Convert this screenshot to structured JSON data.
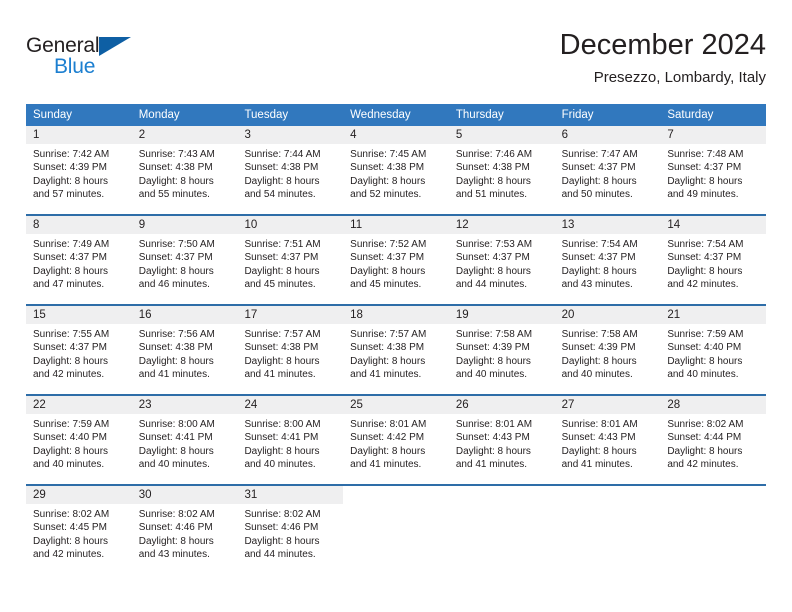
{
  "brand": {
    "name_part1": "General",
    "name_part2": "Blue",
    "flag_icon": "triangle-flag-icon"
  },
  "header": {
    "title": "December 2024",
    "subtitle": "Presezzo, Lombardy, Italy"
  },
  "colors": {
    "header_blue": "#3178be",
    "week_border_blue": "#2e6da8",
    "daynum_background": "#efeff0",
    "brand_blue": "#1c7fd0",
    "brand_flag": "#0e5fa4",
    "text": "#231f20"
  },
  "calendar": {
    "weekday_headers": [
      "Sunday",
      "Monday",
      "Tuesday",
      "Wednesday",
      "Thursday",
      "Friday",
      "Saturday"
    ],
    "weeks": [
      [
        {
          "day": "1",
          "sunrise": "Sunrise: 7:42 AM",
          "sunset": "Sunset: 4:39 PM",
          "daylight1": "Daylight: 8 hours",
          "daylight2": "and 57 minutes."
        },
        {
          "day": "2",
          "sunrise": "Sunrise: 7:43 AM",
          "sunset": "Sunset: 4:38 PM",
          "daylight1": "Daylight: 8 hours",
          "daylight2": "and 55 minutes."
        },
        {
          "day": "3",
          "sunrise": "Sunrise: 7:44 AM",
          "sunset": "Sunset: 4:38 PM",
          "daylight1": "Daylight: 8 hours",
          "daylight2": "and 54 minutes."
        },
        {
          "day": "4",
          "sunrise": "Sunrise: 7:45 AM",
          "sunset": "Sunset: 4:38 PM",
          "daylight1": "Daylight: 8 hours",
          "daylight2": "and 52 minutes."
        },
        {
          "day": "5",
          "sunrise": "Sunrise: 7:46 AM",
          "sunset": "Sunset: 4:38 PM",
          "daylight1": "Daylight: 8 hours",
          "daylight2": "and 51 minutes."
        },
        {
          "day": "6",
          "sunrise": "Sunrise: 7:47 AM",
          "sunset": "Sunset: 4:37 PM",
          "daylight1": "Daylight: 8 hours",
          "daylight2": "and 50 minutes."
        },
        {
          "day": "7",
          "sunrise": "Sunrise: 7:48 AM",
          "sunset": "Sunset: 4:37 PM",
          "daylight1": "Daylight: 8 hours",
          "daylight2": "and 49 minutes."
        }
      ],
      [
        {
          "day": "8",
          "sunrise": "Sunrise: 7:49 AM",
          "sunset": "Sunset: 4:37 PM",
          "daylight1": "Daylight: 8 hours",
          "daylight2": "and 47 minutes."
        },
        {
          "day": "9",
          "sunrise": "Sunrise: 7:50 AM",
          "sunset": "Sunset: 4:37 PM",
          "daylight1": "Daylight: 8 hours",
          "daylight2": "and 46 minutes."
        },
        {
          "day": "10",
          "sunrise": "Sunrise: 7:51 AM",
          "sunset": "Sunset: 4:37 PM",
          "daylight1": "Daylight: 8 hours",
          "daylight2": "and 45 minutes."
        },
        {
          "day": "11",
          "sunrise": "Sunrise: 7:52 AM",
          "sunset": "Sunset: 4:37 PM",
          "daylight1": "Daylight: 8 hours",
          "daylight2": "and 45 minutes."
        },
        {
          "day": "12",
          "sunrise": "Sunrise: 7:53 AM",
          "sunset": "Sunset: 4:37 PM",
          "daylight1": "Daylight: 8 hours",
          "daylight2": "and 44 minutes."
        },
        {
          "day": "13",
          "sunrise": "Sunrise: 7:54 AM",
          "sunset": "Sunset: 4:37 PM",
          "daylight1": "Daylight: 8 hours",
          "daylight2": "and 43 minutes."
        },
        {
          "day": "14",
          "sunrise": "Sunrise: 7:54 AM",
          "sunset": "Sunset: 4:37 PM",
          "daylight1": "Daylight: 8 hours",
          "daylight2": "and 42 minutes."
        }
      ],
      [
        {
          "day": "15",
          "sunrise": "Sunrise: 7:55 AM",
          "sunset": "Sunset: 4:37 PM",
          "daylight1": "Daylight: 8 hours",
          "daylight2": "and 42 minutes."
        },
        {
          "day": "16",
          "sunrise": "Sunrise: 7:56 AM",
          "sunset": "Sunset: 4:38 PM",
          "daylight1": "Daylight: 8 hours",
          "daylight2": "and 41 minutes."
        },
        {
          "day": "17",
          "sunrise": "Sunrise: 7:57 AM",
          "sunset": "Sunset: 4:38 PM",
          "daylight1": "Daylight: 8 hours",
          "daylight2": "and 41 minutes."
        },
        {
          "day": "18",
          "sunrise": "Sunrise: 7:57 AM",
          "sunset": "Sunset: 4:38 PM",
          "daylight1": "Daylight: 8 hours",
          "daylight2": "and 41 minutes."
        },
        {
          "day": "19",
          "sunrise": "Sunrise: 7:58 AM",
          "sunset": "Sunset: 4:39 PM",
          "daylight1": "Daylight: 8 hours",
          "daylight2": "and 40 minutes."
        },
        {
          "day": "20",
          "sunrise": "Sunrise: 7:58 AM",
          "sunset": "Sunset: 4:39 PM",
          "daylight1": "Daylight: 8 hours",
          "daylight2": "and 40 minutes."
        },
        {
          "day": "21",
          "sunrise": "Sunrise: 7:59 AM",
          "sunset": "Sunset: 4:40 PM",
          "daylight1": "Daylight: 8 hours",
          "daylight2": "and 40 minutes."
        }
      ],
      [
        {
          "day": "22",
          "sunrise": "Sunrise: 7:59 AM",
          "sunset": "Sunset: 4:40 PM",
          "daylight1": "Daylight: 8 hours",
          "daylight2": "and 40 minutes."
        },
        {
          "day": "23",
          "sunrise": "Sunrise: 8:00 AM",
          "sunset": "Sunset: 4:41 PM",
          "daylight1": "Daylight: 8 hours",
          "daylight2": "and 40 minutes."
        },
        {
          "day": "24",
          "sunrise": "Sunrise: 8:00 AM",
          "sunset": "Sunset: 4:41 PM",
          "daylight1": "Daylight: 8 hours",
          "daylight2": "and 40 minutes."
        },
        {
          "day": "25",
          "sunrise": "Sunrise: 8:01 AM",
          "sunset": "Sunset: 4:42 PM",
          "daylight1": "Daylight: 8 hours",
          "daylight2": "and 41 minutes."
        },
        {
          "day": "26",
          "sunrise": "Sunrise: 8:01 AM",
          "sunset": "Sunset: 4:43 PM",
          "daylight1": "Daylight: 8 hours",
          "daylight2": "and 41 minutes."
        },
        {
          "day": "27",
          "sunrise": "Sunrise: 8:01 AM",
          "sunset": "Sunset: 4:43 PM",
          "daylight1": "Daylight: 8 hours",
          "daylight2": "and 41 minutes."
        },
        {
          "day": "28",
          "sunrise": "Sunrise: 8:02 AM",
          "sunset": "Sunset: 4:44 PM",
          "daylight1": "Daylight: 8 hours",
          "daylight2": "and 42 minutes."
        }
      ],
      [
        {
          "day": "29",
          "sunrise": "Sunrise: 8:02 AM",
          "sunset": "Sunset: 4:45 PM",
          "daylight1": "Daylight: 8 hours",
          "daylight2": "and 42 minutes."
        },
        {
          "day": "30",
          "sunrise": "Sunrise: 8:02 AM",
          "sunset": "Sunset: 4:46 PM",
          "daylight1": "Daylight: 8 hours",
          "daylight2": "and 43 minutes."
        },
        {
          "day": "31",
          "sunrise": "Sunrise: 8:02 AM",
          "sunset": "Sunset: 4:46 PM",
          "daylight1": "Daylight: 8 hours",
          "daylight2": "and 44 minutes."
        },
        {
          "day": "",
          "sunrise": "",
          "sunset": "",
          "daylight1": "",
          "daylight2": ""
        },
        {
          "day": "",
          "sunrise": "",
          "sunset": "",
          "daylight1": "",
          "daylight2": ""
        },
        {
          "day": "",
          "sunrise": "",
          "sunset": "",
          "daylight1": "",
          "daylight2": ""
        },
        {
          "day": "",
          "sunrise": "",
          "sunset": "",
          "daylight1": "",
          "daylight2": ""
        }
      ]
    ]
  }
}
